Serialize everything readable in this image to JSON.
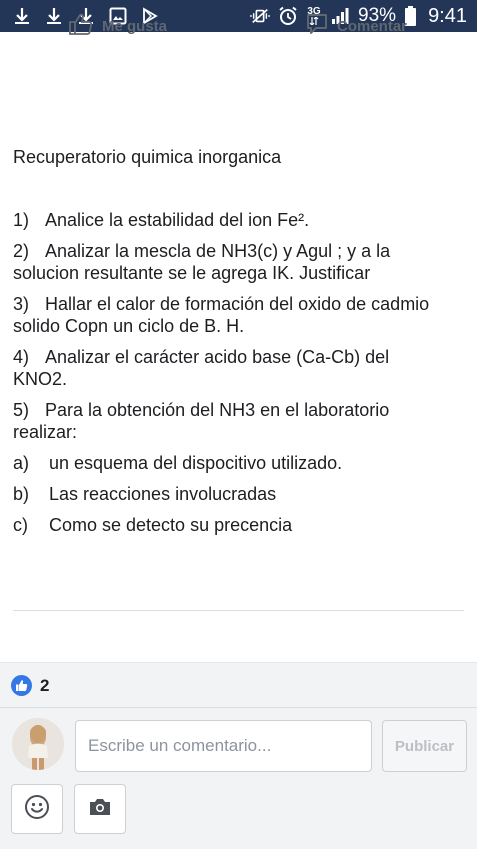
{
  "status_bar": {
    "icons_left": [
      "download-icon",
      "download-icon",
      "download-icon",
      "image-icon",
      "play-store-icon"
    ],
    "icons_right": [
      "mute-vibrate-icon",
      "alarm-icon",
      "network-3g-icon",
      "signal-icon",
      "battery-icon"
    ],
    "network_label": "3G",
    "battery_percent": "93%",
    "time": "9:41",
    "color": "#233658"
  },
  "post": {
    "title": "Recuperatorio quimica inorganica",
    "lines": [
      {
        "num": "1)",
        "text": "Analice la estabilidad del ion Fe²."
      },
      {
        "num": "2)",
        "text": "Analizar la mescla de NH3(c) y Agul ; y a la solucion resultante se le agrega IK. Justificar"
      },
      {
        "num": "3)",
        "text": "Hallar el calor de formación del oxido de cadmio solido Copn un ciclo de B. H."
      },
      {
        "num": "4)",
        "text": "Analizar el carácter acido base (Ca-Cb) del KNO2."
      },
      {
        "num": "5)",
        "text": "Para la obtención del NH3 en el laboratorio realizar:"
      },
      {
        "num": "a)",
        "text": "un esquema del dispocitivo utilizado."
      },
      {
        "num": "b)",
        "text": "Las reacciones involucradas"
      },
      {
        "num": "c)",
        "text": "Como se detecto su precencia"
      }
    ]
  },
  "actions": {
    "like_label": "Me gusta",
    "comment_label": "Comentar"
  },
  "reactions": {
    "count": "2",
    "badge_color": "#3578e5"
  },
  "composer": {
    "placeholder": "Escribe un comentario...",
    "publish_label": "Publicar"
  }
}
